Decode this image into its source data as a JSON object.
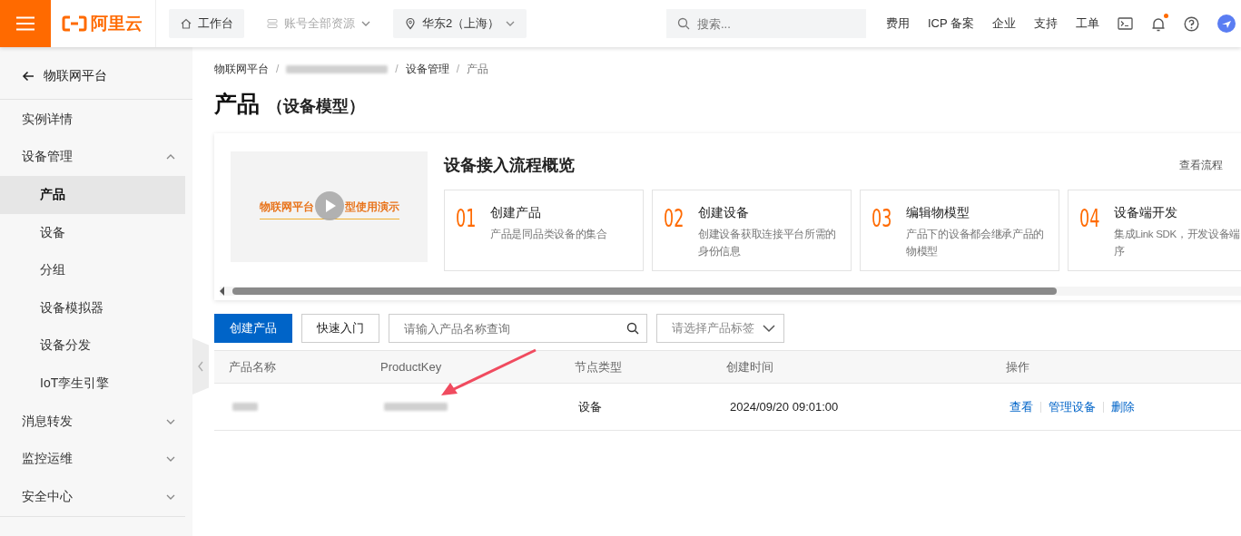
{
  "topbar": {
    "logo": "阿里云",
    "nav": [
      {
        "label": "工作台",
        "kind": "home",
        "disabled": false
      },
      {
        "label": "账号全部资源",
        "kind": "resources",
        "disabled": true
      },
      {
        "label": "华东2（上海）",
        "kind": "region",
        "disabled": false
      }
    ],
    "search": {
      "placeholder": "搜索..."
    },
    "links": [
      "费用",
      "ICP 备案",
      "企业",
      "支持",
      "工单"
    ],
    "notifications": {
      "unread": true
    }
  },
  "sidebar": {
    "back": "物联网平台",
    "items": [
      {
        "label": "实例详情",
        "kind": "item"
      },
      {
        "label": "设备管理",
        "kind": "group",
        "expanded": true,
        "children": [
          {
            "label": "产品",
            "selected": true
          },
          {
            "label": "设备",
            "selected": false
          },
          {
            "label": "分组",
            "selected": false
          },
          {
            "label": "设备模拟器",
            "selected": false
          },
          {
            "label": "设备分发",
            "selected": false
          },
          {
            "label": "IoT孪生引擎",
            "selected": false
          }
        ]
      },
      {
        "label": "消息转发",
        "kind": "group",
        "expanded": false
      },
      {
        "label": "监控运维",
        "kind": "group",
        "expanded": false
      },
      {
        "label": "安全中心",
        "kind": "group",
        "expanded": false
      }
    ]
  },
  "breadcrumb": [
    {
      "kind": "link",
      "label": "物联网平台"
    },
    {
      "kind": "separator",
      "label": "/"
    },
    {
      "kind": "redacted"
    },
    {
      "kind": "separator",
      "label": "/"
    },
    {
      "kind": "link",
      "label": "设备管理"
    },
    {
      "kind": "separator",
      "label": "/"
    },
    {
      "kind": "current",
      "label": "产品"
    }
  ],
  "page": {
    "title": "产品",
    "subtitle": "（设备模型）"
  },
  "flow": {
    "video_title": [
      "物联网平台",
      "型使用演示"
    ],
    "title": "设备接入流程概览",
    "link": "查看流程",
    "steps": [
      {
        "number": "01",
        "title": "创建产品",
        "desc": [
          "产品是同品类设备的集合"
        ]
      },
      {
        "number": "02",
        "title": "创建设备",
        "desc": [
          "创建设备获取连接平台所需的",
          "身份信息"
        ]
      },
      {
        "number": "03",
        "title": "编辑物模型",
        "desc": [
          "产品下的设备都会继承产品的",
          "物模型"
        ]
      },
      {
        "number": "04",
        "title": "设备端开发",
        "desc": [
          "集成Link SDK，开发设备端",
          "序"
        ]
      }
    ]
  },
  "toolbar": {
    "primary": "创建产品",
    "secondary": "快速入门",
    "search": {
      "placeholder": "请输入产品名称查询"
    },
    "tag_select": {
      "placeholder": "请选择产品标签"
    }
  },
  "table": {
    "columns": [
      "产品名称",
      "ProductKey",
      "节点类型",
      "创建时间",
      "操作"
    ],
    "rows": [
      {
        "cells": [
          {
            "kind": "redacted"
          },
          {
            "kind": "redacted"
          },
          {
            "kind": "text",
            "text": "设备"
          },
          {
            "kind": "text",
            "text": "2024/09/20 09:01:00"
          },
          {
            "kind": "actions",
            "actions": [
              "查看",
              "管理设备",
              "删除"
            ]
          }
        ]
      }
    ]
  }
}
